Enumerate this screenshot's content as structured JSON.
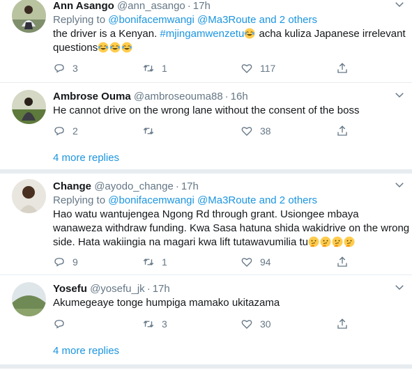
{
  "tweets": [
    {
      "name": "Ann Asango",
      "handle": "@ann_asango",
      "time": "17h",
      "replying_prefix": "Replying to",
      "replying_to": "@bonifacemwangi @Ma3Route and 2 others",
      "text_line1_before": "the driver is a Kenyan.",
      "text_line1_hashtag": "#mjingamwenzetu",
      "text_line1_after": "acha kuliza Japanese irrelevant",
      "text_line2": "questions",
      "emoji_line1": "laughing-emoji",
      "emoji_line2": "laughing-emoji x3",
      "replies": "3",
      "retweets": "1",
      "likes": "117"
    },
    {
      "name": "Ambrose Ouma",
      "handle": "@ambroseouma88",
      "time": "16h",
      "text": "He cannot drive on the wrong lane without the consent of the boss",
      "replies": "2",
      "retweets": "",
      "likes": "38"
    },
    {
      "name": "Change",
      "handle": "@ayodo_change",
      "time": "17h",
      "replying_prefix": "Replying to",
      "replying_to": "@bonifacemwangi @Ma3Route and 2 others",
      "text_line1": "Hao watu wantujengea Ngong Rd through grant. Usiongee mbaya",
      "text_line2": "wanaweza withdraw funding. Kwa Sasa hatuna shida wakidrive on the wrong",
      "text_line3": "side. Hata wakiingia na magari kwa lift tutawavumilia tu",
      "emoji_line3": "thinking-emoji x4",
      "replies": "9",
      "retweets": "1",
      "likes": "94"
    },
    {
      "name": "Yosefu",
      "handle": "@yosefu_jk",
      "time": "17h",
      "text": "Akumegeaye tonge humpiga mamako ukitazama",
      "replies": "",
      "retweets": "3",
      "likes": "30"
    }
  ],
  "more_replies_1": "4 more replies",
  "more_replies_2": "4 more replies",
  "dot": "·",
  "colors": {
    "link": "#1b95e0",
    "muted": "#657786",
    "separator": "#e6ecf0"
  }
}
